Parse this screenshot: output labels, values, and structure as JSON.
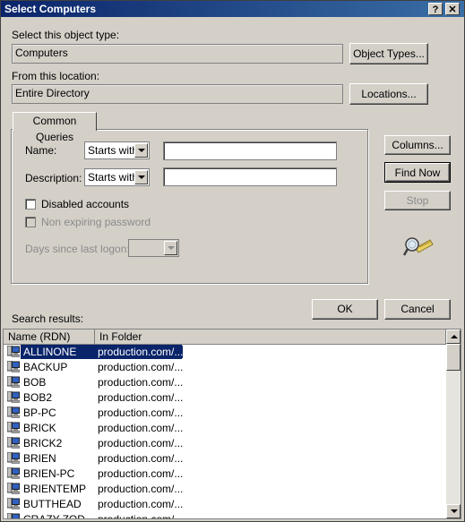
{
  "window": {
    "title": "Select Computers",
    "help_label": "?",
    "close_label": "✕"
  },
  "object_type": {
    "label": "Select this object type:",
    "value": "Computers",
    "button": "Object Types..."
  },
  "location": {
    "label": "From this location:",
    "value": "Entire Directory",
    "button": "Locations..."
  },
  "queries": {
    "tab_label": "Common Queries",
    "name_label": "Name:",
    "name_operator": "Starts with",
    "name_value": "",
    "description_label": "Description:",
    "description_operator": "Starts with",
    "description_value": "",
    "disabled_accounts_label": "Disabled accounts",
    "non_expiring_label": "Non expiring password",
    "days_label": "Days since last logon:",
    "days_value": ""
  },
  "side_buttons": {
    "columns": "Columns...",
    "find_now": "Find Now",
    "stop": "Stop"
  },
  "dialog_buttons": {
    "ok": "OK",
    "cancel": "Cancel"
  },
  "results": {
    "label": "Search results:",
    "columns": [
      "Name (RDN)",
      "In Folder"
    ],
    "rows": [
      {
        "name": "ALLINONE",
        "folder": "production.com/...",
        "selected": true
      },
      {
        "name": "BACKUP",
        "folder": "production.com/..."
      },
      {
        "name": "BOB",
        "folder": "production.com/..."
      },
      {
        "name": "BOB2",
        "folder": "production.com/..."
      },
      {
        "name": "BP-PC",
        "folder": "production.com/..."
      },
      {
        "name": "BRICK",
        "folder": "production.com/..."
      },
      {
        "name": "BRICK2",
        "folder": "production.com/..."
      },
      {
        "name": "BRIEN",
        "folder": "production.com/..."
      },
      {
        "name": "BRIEN-PC",
        "folder": "production.com/..."
      },
      {
        "name": "BRIENTEMP",
        "folder": "production.com/..."
      },
      {
        "name": "BUTTHEAD",
        "folder": "production.com/..."
      },
      {
        "name": "CRAZY-ZOD",
        "folder": "production.com/..."
      }
    ]
  },
  "colors": {
    "title_bar": "#0a246a",
    "dialog_bg": "#d4d0c8",
    "selection": "#0a246a"
  },
  "icons": {
    "search": "search-magnifier-icon",
    "computer": "computer-icon"
  }
}
